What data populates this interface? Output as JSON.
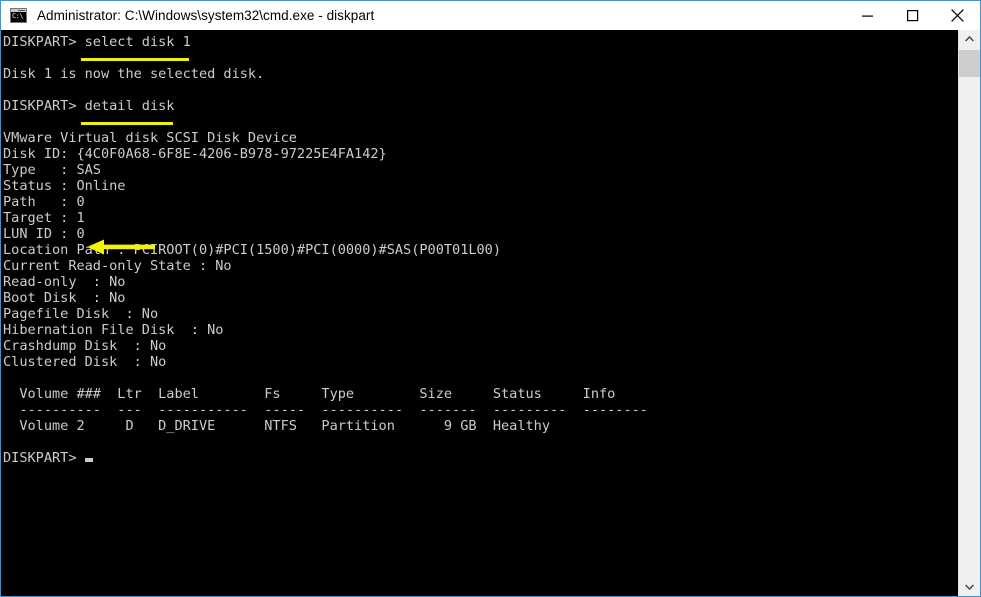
{
  "window": {
    "title": "Administrator: C:\\Windows\\system32\\cmd.exe - diskpart",
    "icon_text": "C:\\",
    "icon_name": "cmd-console-icon",
    "border_color": "#4a90c4",
    "titlebar_bg": "#ffffff",
    "console_bg": "#000000",
    "console_fg": "#cccccc",
    "highlight_color": "#f4f400"
  },
  "buttons": {
    "minimize": "minimize",
    "maximize": "maximize",
    "close": "close"
  },
  "scrollbar": {
    "up_arrow": "scroll-up",
    "down_arrow": "scroll-down",
    "thumb": "scroll-thumb"
  },
  "terminal": {
    "lines": [
      "DISKPART> select disk 1",
      "",
      "Disk 1 is now the selected disk.",
      "",
      "DISKPART> detail disk",
      "",
      "VMware Virtual disk SCSI Disk Device",
      "Disk ID: {4C0F0A68-6F8E-4206-B978-97225E4FA142}",
      "Type   : SAS",
      "Status : Online",
      "Path   : 0",
      "Target : 1",
      "LUN ID : 0",
      "Location Path : PCIROOT(0)#PCI(1500)#PCI(0000)#SAS(P00T01L00)",
      "Current Read-only State : No",
      "Read-only  : No",
      "Boot Disk  : No",
      "Pagefile Disk  : No",
      "Hibernation File Disk  : No",
      "Crashdump Disk  : No",
      "Clustered Disk  : No",
      "",
      "  Volume ###  Ltr  Label        Fs     Type        Size     Status     Info",
      "  ----------  ---  -----------  -----  ----------  -------  ---------  --------",
      "  Volume 2     D   D_DRIVE      NTFS   Partition      9 GB  Healthy",
      "",
      "DISKPART>"
    ],
    "prompt_label": "DISKPART>",
    "commands": [
      {
        "text": "select disk 1",
        "highlighted": true
      },
      {
        "text": "detail disk",
        "highlighted": true
      }
    ],
    "disk_detail": {
      "device": "VMware Virtual disk SCSI Disk Device",
      "disk_id": "{4C0F0A68-6F8E-4206-B978-97225E4FA142}",
      "type": "SAS",
      "status": "Online",
      "path": "0",
      "target": "1",
      "lun_id": "0",
      "location_path": "PCIROOT(0)#PCI(1500)#PCI(0000)#SAS(P00T01L00)",
      "current_read_only_state": "No",
      "read_only": "No",
      "boot_disk": "No",
      "pagefile_disk": "No",
      "hibernation_file_disk": "No",
      "crashdump_disk": "No",
      "clustered_disk": "No"
    },
    "volume_table": {
      "headers": [
        "Volume ###",
        "Ltr",
        "Label",
        "Fs",
        "Type",
        "Size",
        "Status",
        "Info"
      ],
      "rows": [
        [
          "Volume 2",
          "D",
          "D_DRIVE",
          "NTFS",
          "Partition",
          "9 GB",
          "Healthy",
          ""
        ]
      ]
    },
    "messages": [
      "Disk 1 is now the selected disk."
    ],
    "annotations": {
      "lun_id_arrow": "arrow pointing left at LUN ID value",
      "arrow_color": "#f4f400"
    }
  }
}
